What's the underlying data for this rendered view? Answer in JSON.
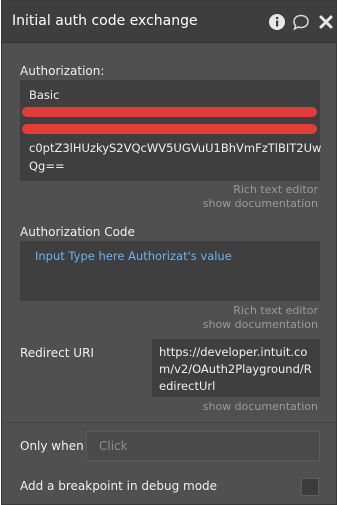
{
  "header": {
    "title": "Initial auth code exchange"
  },
  "icons": {
    "info": "info-icon",
    "comment": "comment-icon",
    "close": "close-icon"
  },
  "authorization": {
    "label": "Authorization:",
    "line1": "Basic",
    "line4": "c0ptZ3lHUzkyS2VQcWV5UGVuU1BhVmFzTlBIT2Uw",
    "line5": "Qg==",
    "editor_link": "Rich text editor",
    "doc_link": "show documentation",
    "redacted_lines": 2
  },
  "authorization_code": {
    "label": "Authorization Code",
    "placeholder": "Input Type here Authorizat's value",
    "editor_link": "Rich text editor",
    "doc_link": "show documentation"
  },
  "redirect_uri": {
    "label": "Redirect URI",
    "line1": "https://developer.intuit.co",
    "line2": "m/v2/OAuth2Playground/R",
    "line3": "edirectUrl",
    "doc_link": "show documentation"
  },
  "only_when": {
    "label": "Only when",
    "placeholder": "Click"
  },
  "breakpoint": {
    "label": "Add a breakpoint in debug mode",
    "checked": false
  },
  "colors": {
    "panel_bg": "#505050",
    "header_bg": "#3e3e3e",
    "field_bg": "#3f3f3f",
    "redaction": "#e13d3a",
    "placeholder_link": "#6fb2ee"
  }
}
